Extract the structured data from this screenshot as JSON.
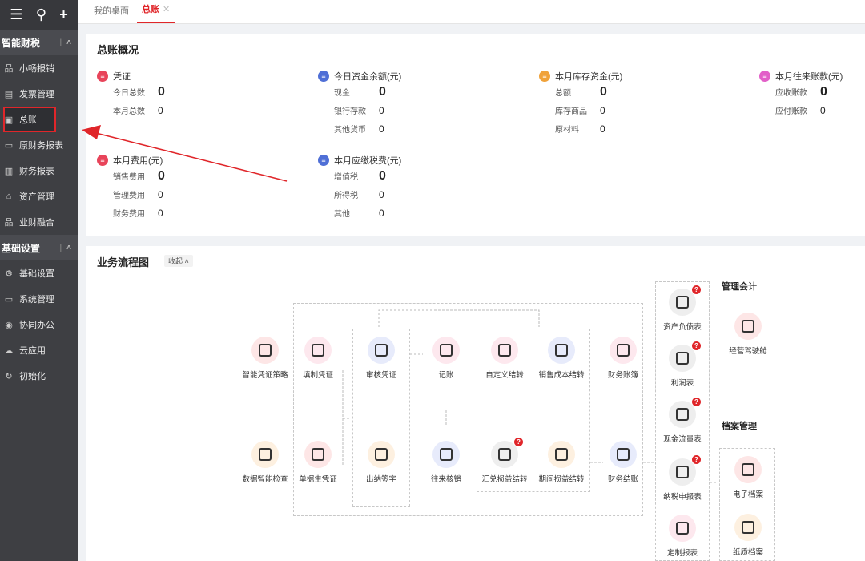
{
  "sidebar": {
    "top_icons": [
      "menu-icon",
      "search-icon",
      "plus-icon"
    ],
    "groups": [
      {
        "label": "智能财税",
        "items": [
          "小畅报销",
          "发票管理",
          "总账",
          "原财务报表",
          "财务报表",
          "资产管理",
          "业财融合"
        ]
      },
      {
        "label": "基础设置",
        "items": [
          "基础设置",
          "系统管理",
          "协同办公",
          "云应用",
          "初始化"
        ]
      }
    ]
  },
  "tabs": [
    {
      "label": "我的桌面"
    },
    {
      "label": "总账",
      "close": "✕"
    }
  ],
  "overview": {
    "title": "总账概况",
    "cards": [
      {
        "title": "凭证",
        "color": "#e8445a",
        "rows": [
          [
            "今日总数",
            "0"
          ],
          [
            "本月总数",
            "0"
          ]
        ]
      },
      {
        "title": "今日资金余额(元)",
        "color": "#4f6fd6",
        "rows": [
          [
            "现金",
            "0"
          ],
          [
            "银行存款",
            "0"
          ],
          [
            "其他货币",
            "0"
          ]
        ]
      },
      {
        "title": "本月库存资金(元)",
        "color": "#f0a23a",
        "rows": [
          [
            "总额",
            "0"
          ],
          [
            "库存商品",
            "0"
          ],
          [
            "原材料",
            "0"
          ]
        ]
      },
      {
        "title": "本月往来账款(元)",
        "color": "#e260c8",
        "rows": [
          [
            "应收账款",
            "0"
          ],
          [
            "应付账款",
            "0"
          ]
        ]
      },
      {
        "title": "本月费用(元)",
        "color": "#e8445a",
        "rows": [
          [
            "销售费用",
            "0"
          ],
          [
            "管理费用",
            "0"
          ],
          [
            "财务费用",
            "0"
          ]
        ]
      },
      {
        "title": "本月应缴税费(元)",
        "color": "#4f6fd6",
        "rows": [
          [
            "增值税",
            "0"
          ],
          [
            "所得税",
            "0"
          ],
          [
            "其他",
            "0"
          ]
        ]
      }
    ]
  },
  "flow": {
    "title": "业务流程图",
    "collapse_label": "收起 ˄",
    "mgmt_title": "管理会计",
    "archive_title": "档案管理",
    "nodes": {
      "smart_voucher": "智能凭证策略",
      "fill_voucher": "填制凭证",
      "review_voucher": "审核凭证",
      "bookkeeping": "记账",
      "custom_close": "自定义结转",
      "sales_cost": "销售成本结转",
      "fin_books": "财务账簿",
      "data_check": "数据智能检查",
      "doc_voucher": "单据生凭证",
      "cashier_sign": "出纳签字",
      "reconcile": "往来核销",
      "fx_close": "汇兑损益结转",
      "period_close": "期间损益结转",
      "fin_close": "财务结账",
      "balance_sheet": "资产负债表",
      "income_stmt": "利润表",
      "cash_flow": "现金流量表",
      "tax_report": "纳税申报表",
      "custom_report": "定制报表",
      "cockpit": "经营驾驶舱",
      "e_archive": "电子档案",
      "paper_archive": "纸质档案"
    },
    "badge_q": "?"
  }
}
